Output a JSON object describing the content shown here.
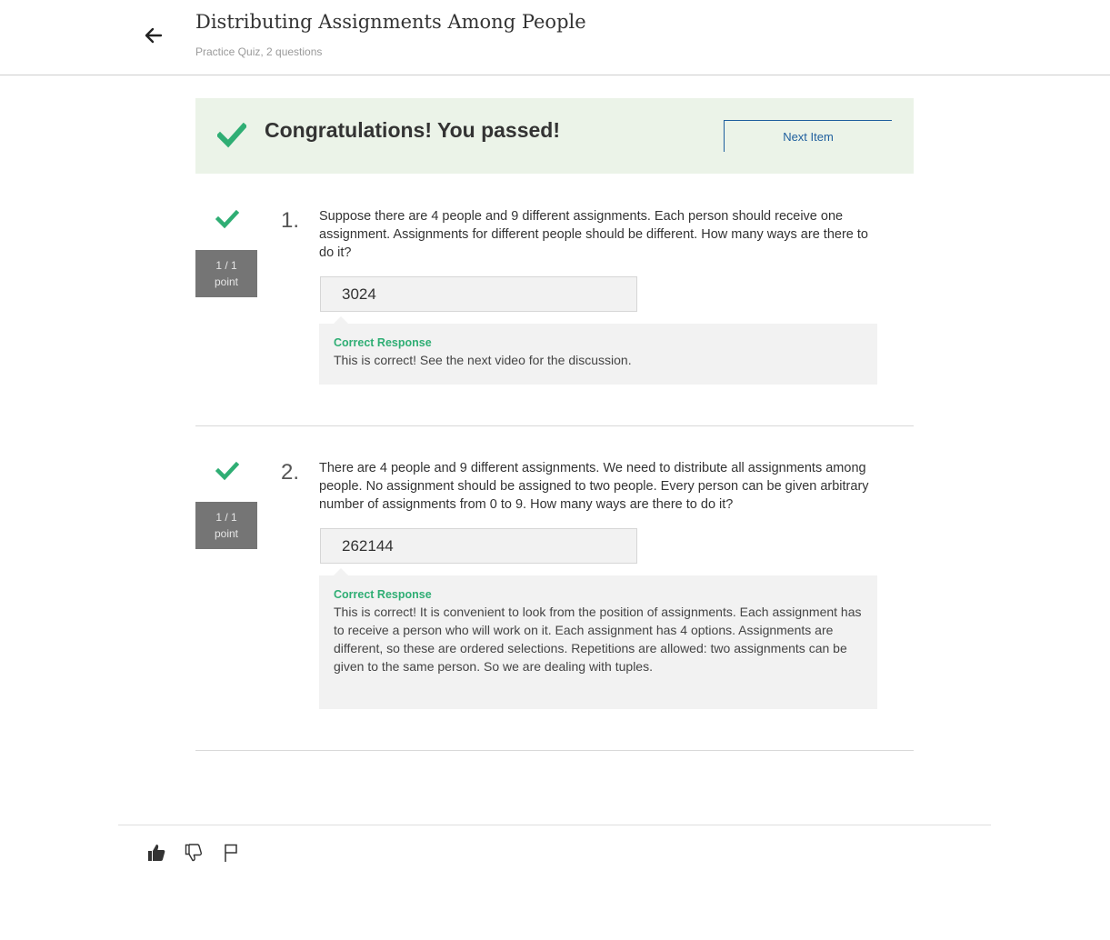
{
  "header": {
    "title": "Distributing Assignments Among People",
    "subtitle": "Practice Quiz, 2 questions"
  },
  "banner": {
    "message": "Congratulations! You passed!",
    "next_label": "Next Item"
  },
  "questions": [
    {
      "number": "1.",
      "points_line1": "1 / 1",
      "points_line2": "point",
      "text": "Suppose there are 4 people and 9 different assignments. Each person should receive one assignment. Assignments for different people should be different. How many ways are there to do it?",
      "answer": "3024",
      "feedback_title": "Correct Response",
      "feedback_text": "This is correct! See the next video for the discussion."
    },
    {
      "number": "2.",
      "points_line1": "1 / 1",
      "points_line2": "point",
      "text": "There are 4 people and 9 different assignments. We need to distribute all assignments among people. No assignment should be assigned to two people. Every person can be given arbitrary number of assignments from 0 to 9. How many ways are there to do it?",
      "answer": "262144",
      "feedback_title": "Correct Response",
      "feedback_text": "This is correct! It is convenient to look from the position of assignments. Each assignment has to receive a person who will work on it. Each assignment has 4 options. Assignments are different, so these are ordered selections. Repetitions are allowed: two assignments can be given to the same person. So we are dealing with tuples."
    }
  ],
  "footer": {
    "icons": [
      "thumbs-up-icon",
      "thumbs-down-icon",
      "flag-icon"
    ]
  },
  "colors": {
    "success_green": "#2fae74",
    "banner_bg": "#ebf3e8",
    "link_blue": "#1f5f9e",
    "points_bg": "#757575"
  }
}
